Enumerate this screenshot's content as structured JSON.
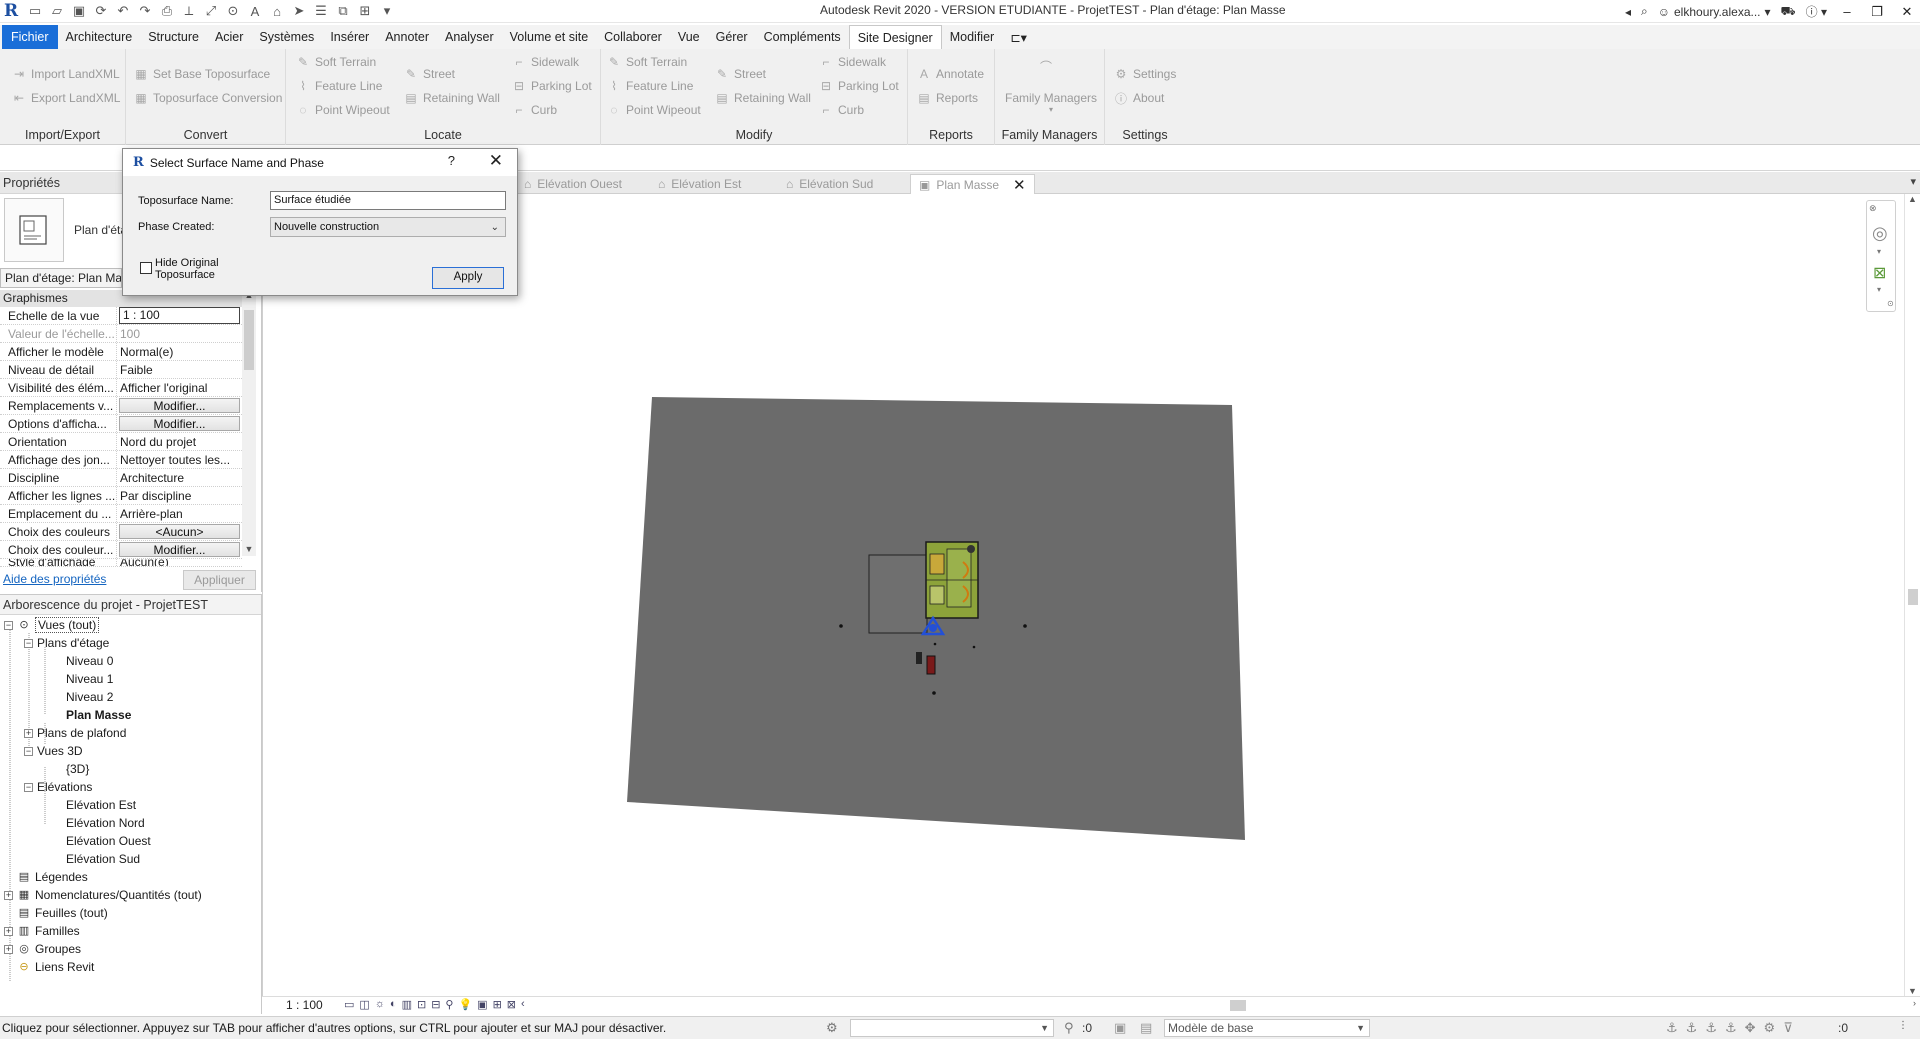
{
  "titlebar": {
    "title": "Autodesk Revit 2020 - VERSION ETUDIANTE - ProjetTEST - Plan d'étage: Plan Masse",
    "user": "elkhoury.alexa...",
    "qat_icons": [
      "open-icon",
      "save-icon",
      "sync-icon",
      "undo-icon",
      "redo-icon",
      "print-icon",
      "measure-icon",
      "text-icon",
      "3d-view-icon",
      "section-icon",
      "thin-lines-icon",
      "close-hidden-icon",
      "switch-windows-icon",
      "customize-icon"
    ]
  },
  "tabs": [
    "Fichier",
    "Architecture",
    "Structure",
    "Acier",
    "Systèmes",
    "Insérer",
    "Annoter",
    "Analyser",
    "Volume et site",
    "Collaborer",
    "Vue",
    "Gérer",
    "Compléments",
    "Site Designer",
    "Modifier"
  ],
  "active_tab": "Site Designer",
  "ribbon": {
    "import_export": {
      "title": "Import/Export",
      "items": [
        "Import LandXML",
        "Export LandXML"
      ]
    },
    "convert": {
      "title": "Convert",
      "items": [
        "Set Base Toposurface",
        "Toposurface Conversion"
      ]
    },
    "locate": {
      "title": "Locate",
      "items": [
        "Soft Terrain",
        "Feature Line",
        "Point Wipeout",
        "Street",
        "Retaining Wall",
        "Sidewalk",
        "Parking Lot",
        "Curb"
      ]
    },
    "modify": {
      "title": "Modify",
      "items": [
        "Soft Terrain",
        "Feature Line",
        "Point Wipeout",
        "Street",
        "Retaining Wall",
        "Sidewalk",
        "Parking Lot",
        "Curb"
      ]
    },
    "reports": {
      "title": "Reports",
      "items": [
        "Annotate",
        "Reports"
      ]
    },
    "family_managers": {
      "title": "Family Managers",
      "items": [
        "Family Managers"
      ]
    },
    "settings": {
      "title": "Settings",
      "items": [
        "Settings",
        "About"
      ]
    }
  },
  "properties": {
    "header": "Propriétés",
    "type_name": "Plan d'éta",
    "type_selector": "Plan d'étage: Plan Ma",
    "group": "Graphismes",
    "rows": [
      {
        "name": "Echelle de la vue",
        "value": "1 : 100",
        "kind": "input"
      },
      {
        "name": "Valeur de l'échelle...",
        "value": "100",
        "kind": "disabled"
      },
      {
        "name": "Afficher le modèle",
        "value": "Normal(e)",
        "kind": "text"
      },
      {
        "name": "Niveau de détail",
        "value": "Faible",
        "kind": "text"
      },
      {
        "name": "Visibilité des élém...",
        "value": "Afficher l'original",
        "kind": "text"
      },
      {
        "name": "Remplacements v...",
        "value": "Modifier...",
        "kind": "button"
      },
      {
        "name": "Options d'afficha...",
        "value": "Modifier...",
        "kind": "button"
      },
      {
        "name": "Orientation",
        "value": "Nord du projet",
        "kind": "text"
      },
      {
        "name": "Affichage des jon...",
        "value": "Nettoyer toutes les...",
        "kind": "text"
      },
      {
        "name": "Discipline",
        "value": "Architecture",
        "kind": "text"
      },
      {
        "name": "Afficher les lignes ...",
        "value": "Par discipline",
        "kind": "text"
      },
      {
        "name": "Emplacement du ...",
        "value": "Arrière-plan",
        "kind": "text"
      },
      {
        "name": "Choix des couleurs",
        "value": "<Aucun>",
        "kind": "button"
      },
      {
        "name": "Choix des couleur...",
        "value": "Modifier...",
        "kind": "button"
      },
      {
        "name": "Style d'affichage",
        "value": "Aucun(e)",
        "kind": "text"
      }
    ],
    "help_link": "Aide des propriétés",
    "apply": "Appliquer"
  },
  "browser": {
    "header": "Arborescence du projet - ProjetTEST",
    "items": [
      {
        "label": "Vues (tout)",
        "level": 0,
        "toggle": "−",
        "icon": "views-icon",
        "selected": true
      },
      {
        "label": "Plans d'étage",
        "level": 1,
        "toggle": "−"
      },
      {
        "label": "Niveau 0",
        "level": 2
      },
      {
        "label": "Niveau 1",
        "level": 2
      },
      {
        "label": "Niveau 2",
        "level": 2
      },
      {
        "label": "Plan Masse",
        "level": 2,
        "bold": true
      },
      {
        "label": "Plans de plafond",
        "level": 1,
        "toggle": "+"
      },
      {
        "label": "Vues 3D",
        "level": 1,
        "toggle": "−"
      },
      {
        "label": "{3D}",
        "level": 2
      },
      {
        "label": "Elévations",
        "level": 1,
        "toggle": "−"
      },
      {
        "label": "Elévation Est",
        "level": 2
      },
      {
        "label": "Elévation Nord",
        "level": 2
      },
      {
        "label": "Elévation Ouest",
        "level": 2
      },
      {
        "label": "Elévation Sud",
        "level": 2
      },
      {
        "label": "Légendes",
        "level": 0,
        "icon": "legend-icon"
      },
      {
        "label": "Nomenclatures/Quantités (tout)",
        "level": 0,
        "toggle": "+",
        "icon": "schedule-icon"
      },
      {
        "label": "Feuilles (tout)",
        "level": 0,
        "icon": "sheet-icon"
      },
      {
        "label": "Familles",
        "level": 0,
        "toggle": "+",
        "icon": "family-icon"
      },
      {
        "label": "Groupes",
        "level": 0,
        "toggle": "+",
        "icon": "group-icon"
      },
      {
        "label": "Liens Revit",
        "level": 0,
        "icon": "link-icon"
      }
    ]
  },
  "view_tabs": [
    {
      "label": "Elévation Ouest",
      "icon": "elevation-icon"
    },
    {
      "label": "Elévation Est",
      "icon": "elevation-icon"
    },
    {
      "label": "Elévation Sud",
      "icon": "elevation-icon"
    },
    {
      "label": "Plan Masse",
      "icon": "plan-icon",
      "active": true
    }
  ],
  "view_control": {
    "scale": "1 : 100"
  },
  "status": {
    "message": "Cliquez pour sélectionner. Appuyez sur TAB pour afficher d'autres options, sur CTRL pour ajouter et sur MAJ pour désactiver.",
    "model_dropdown": "Modèle de base",
    "count1": ":0",
    "count2": ":0"
  },
  "dialog": {
    "title": "Select Surface Name and Phase",
    "name_label": "Toposurface Name:",
    "name_value": "Surface étudiée",
    "phase_label": "Phase Created:",
    "phase_value": "Nouvelle construction",
    "hide_label": "Hide Original Toposurface",
    "hide_checked": false,
    "apply_label": "Apply",
    "help": "?"
  },
  "colors": {
    "file_tab": "#1a6ed8",
    "toposurface": "#6b6b6b",
    "building_green": "#8da33a"
  }
}
